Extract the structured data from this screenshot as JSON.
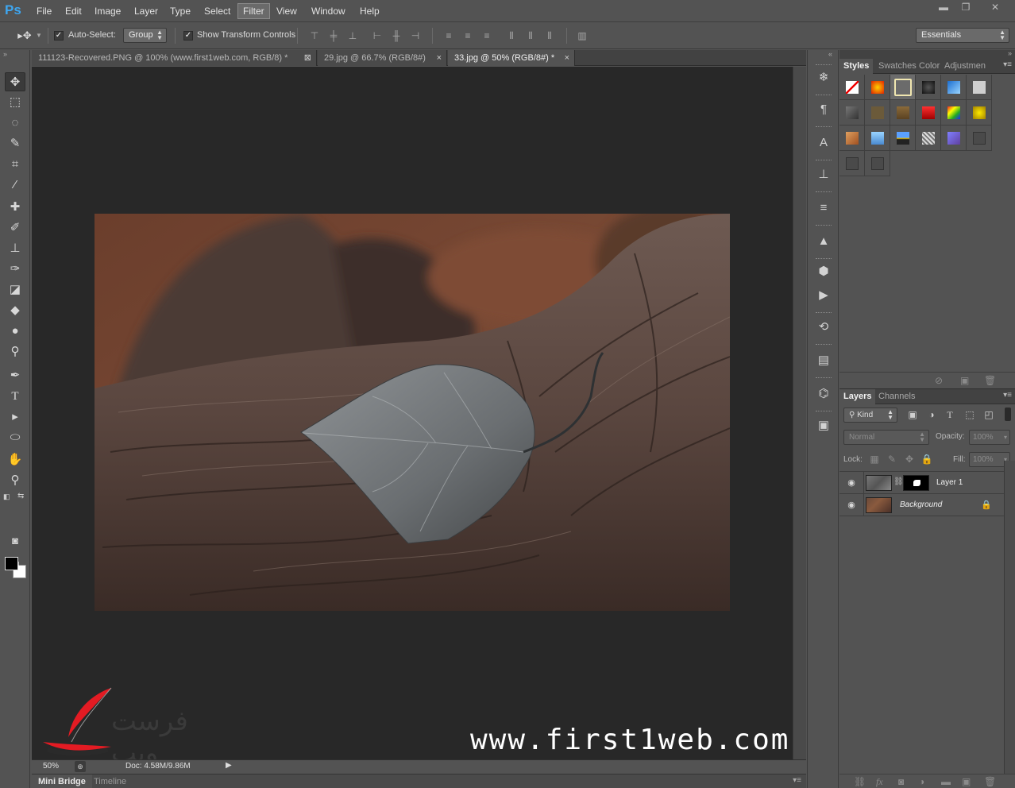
{
  "app": {
    "logo": "Ps"
  },
  "menu": [
    "File",
    "Edit",
    "Image",
    "Layer",
    "Type",
    "Select",
    "Filter",
    "View",
    "Window",
    "Help"
  ],
  "menu_active": "Filter",
  "window_controls": {
    "minimize": "▬",
    "restore": "❐",
    "close": "✕"
  },
  "options": {
    "auto_select_label": "Auto-Select:",
    "auto_select_value": "Group",
    "show_transform_label": "Show Transform Controls",
    "workspace": "Essentials"
  },
  "doc_tabs": [
    {
      "label": "111123-Recovered.PNG @ 100% (www.first1web.com, RGB/8) *"
    },
    {
      "label": "29.jpg @ 66.7% (RGB/8#)"
    },
    {
      "label": "33.jpg @ 50% (RGB/8#) *"
    }
  ],
  "status": {
    "zoom": "50%",
    "doc": "Doc: 4.58M/9.86M"
  },
  "bottom_tabs": [
    "Mini Bridge",
    "Timeline"
  ],
  "styles_panel": {
    "tabs": [
      "Styles",
      "Swatches",
      "Color",
      "Adjustmen"
    ]
  },
  "layers_panel": {
    "tabs": [
      "Layers",
      "Channels"
    ],
    "kind_filter": "Kind",
    "blend_mode": "Normal",
    "opacity_label": "Opacity:",
    "opacity_value": "100%",
    "lock_label": "Lock:",
    "fill_label": "Fill:",
    "fill_value": "100%",
    "layers": [
      {
        "name": "Layer 1"
      },
      {
        "name": "Background"
      }
    ]
  },
  "watermark": {
    "url": "www.first1web.com",
    "arabic": "فرست ويب"
  },
  "colors": {
    "accent": "#3ea6f0",
    "panel_bg": "#535353",
    "canvas_bg": "#282828"
  }
}
